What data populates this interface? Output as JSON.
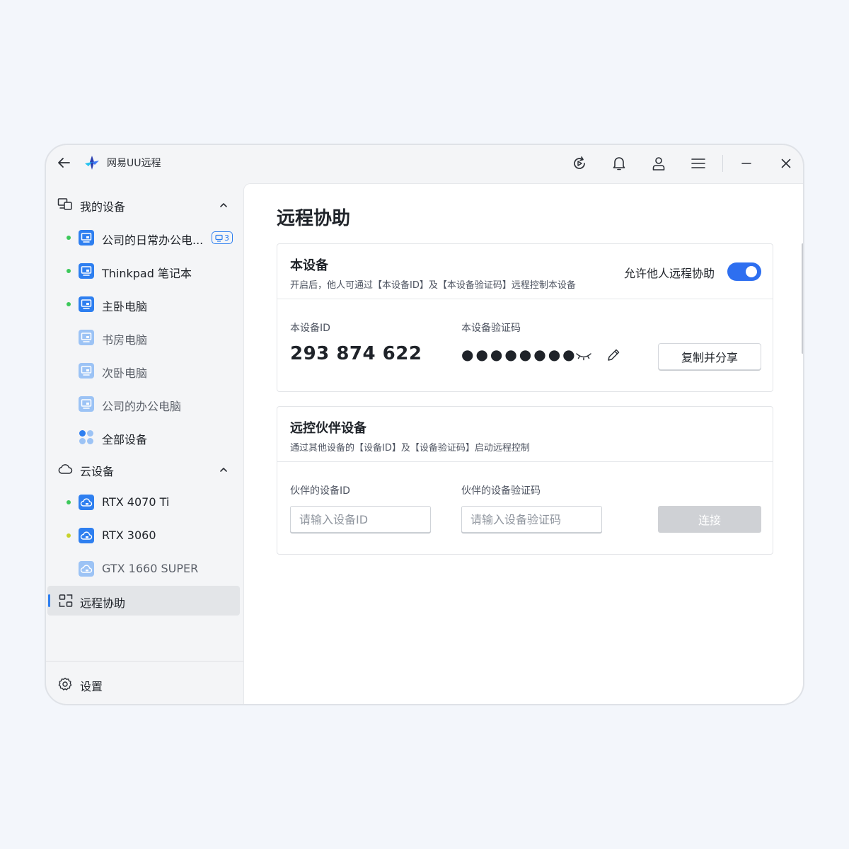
{
  "app": {
    "name": "网易UU远程"
  },
  "titlebar": {
    "icons": [
      "back-arrow-icon",
      "refresh-icon",
      "bell-icon",
      "user-icon",
      "menu-icon",
      "minimize-icon",
      "close-icon"
    ]
  },
  "sidebar": {
    "my_devices": {
      "label": "我的设备",
      "items": [
        {
          "label": "公司的日常办公电...",
          "online": true,
          "badge": "3",
          "status_color": "#3cc85a"
        },
        {
          "label": "Thinkpad 笔记本",
          "online": true,
          "status_color": "#3cc85a"
        },
        {
          "label": "主卧电脑",
          "online": true,
          "status_color": "#3cc85a"
        },
        {
          "label": "书房电脑",
          "online": false
        },
        {
          "label": "次卧电脑",
          "online": false
        },
        {
          "label": "公司的办公电脑",
          "online": false
        }
      ],
      "all_label": "全部设备"
    },
    "cloud_devices": {
      "label": "云设备",
      "items": [
        {
          "label": "RTX 4070 Ti",
          "online": true,
          "status_color": "#3cc85a"
        },
        {
          "label": "RTX 3060",
          "online": true,
          "status_color": "#c8d22a"
        },
        {
          "label": "GTX 1660 SUPER",
          "online": false
        }
      ]
    },
    "remote_assist": {
      "label": "远程协助"
    },
    "settings": {
      "label": "设置"
    }
  },
  "main": {
    "title": "远程协助",
    "this_device": {
      "title": "本设备",
      "desc": "开启后，他人可通过【本设备ID】及【本设备验证码】远程控制本设备",
      "allow_label": "允许他人远程协助",
      "allow_enabled": true,
      "id_label": "本设备ID",
      "id_value": "293 874 622",
      "code_label": "本设备验证码",
      "code_masked": "●●●●●●●●",
      "copy_button": "复制并分享"
    },
    "partner": {
      "title": "远控伙伴设备",
      "desc": "通过其他设备的【设备ID】及【设备验证码】启动远程控制",
      "id_label": "伙伴的设备ID",
      "id_placeholder": "请输入设备ID",
      "code_label": "伙伴的设备验证码",
      "code_placeholder": "请输入设备验证码",
      "connect_button": "连接"
    }
  },
  "colors": {
    "accent": "#2e6ff0",
    "online": "#3cc85a",
    "device_icon": "#2e7ff0",
    "device_icon_dim": "#9cc3f5"
  }
}
